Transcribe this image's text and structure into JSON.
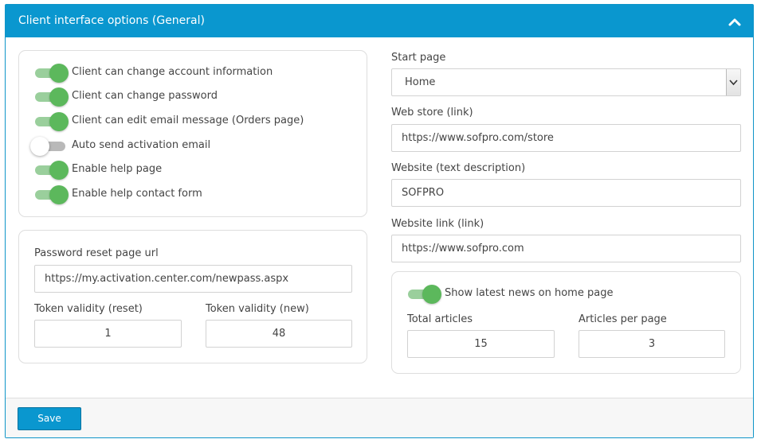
{
  "panel": {
    "title": "Client interface options (General)"
  },
  "toggles": [
    {
      "label": "Client can change account information",
      "on": true
    },
    {
      "label": "Client can change password",
      "on": true
    },
    {
      "label": "Client can edit email message (Orders page)",
      "on": true
    },
    {
      "label": "Auto send activation email",
      "on": false
    },
    {
      "label": "Enable help page",
      "on": true
    },
    {
      "label": "Enable help contact form",
      "on": true
    }
  ],
  "password_reset": {
    "url_label": "Password reset page url",
    "url_value": "https://my.activation.center.com/newpass.aspx",
    "token_reset_label": "Token validity (reset)",
    "token_reset_value": "1",
    "token_new_label": "Token validity (new)",
    "token_new_value": "48"
  },
  "start_page": {
    "label": "Start page",
    "value": "Home"
  },
  "web_store": {
    "label": "Web store (link)",
    "value": "https://www.sofpro.com/store"
  },
  "website_text": {
    "label": "Website (text description)",
    "value": "SOFPRO"
  },
  "website_link": {
    "label": "Website link (link)",
    "value": "https://www.sofpro.com"
  },
  "news": {
    "toggle_label": "Show latest news on home page",
    "toggle_on": true,
    "total_label": "Total articles",
    "total_value": "15",
    "per_page_label": "Articles per page",
    "per_page_value": "3"
  },
  "footer": {
    "save_label": "Save"
  },
  "colors": {
    "header": "#0a97cf",
    "toggle_on": "#5cb85c",
    "toggle_off": "#b9b9b9"
  }
}
